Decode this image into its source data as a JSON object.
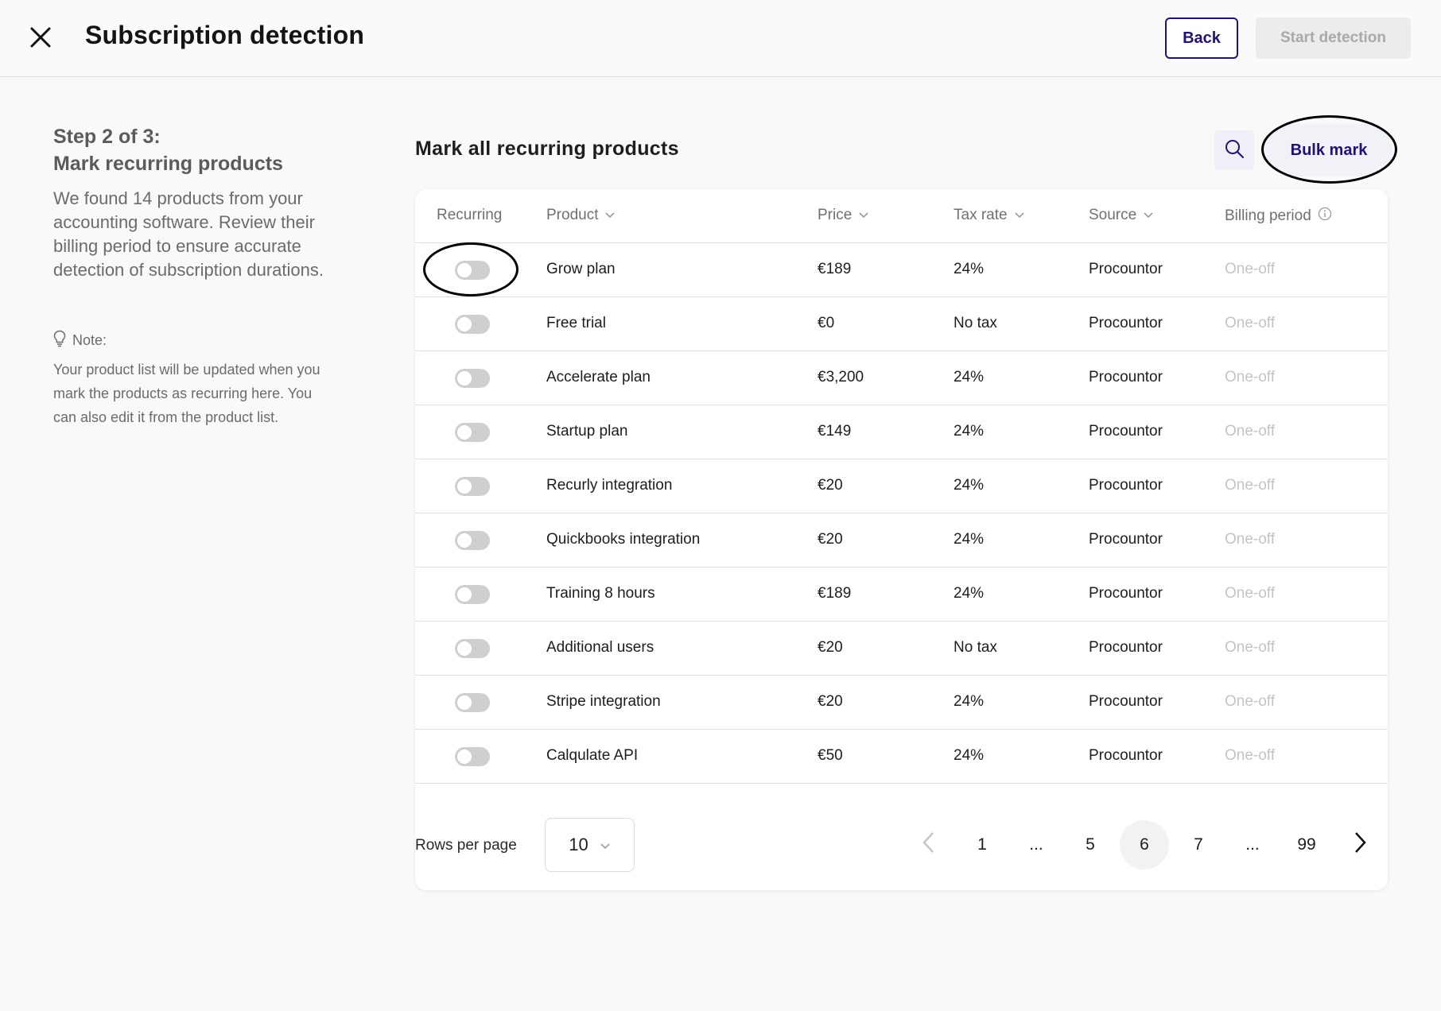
{
  "header": {
    "title": "Subscription detection",
    "back_label": "Back",
    "start_label": "Start detection"
  },
  "left": {
    "step_line1": "Step 2 of 3:",
    "step_line2": "Mark recurring products",
    "description": "We found 14 products from your accounting software. Review their billing period to ensure accurate detection of subscription durations.",
    "note_label": "Note:",
    "note_text": "Your product list will be updated when you mark the products as recurring here. You can also edit it from the product list."
  },
  "main": {
    "heading": "Mark all recurring products",
    "bulk_label": "Bulk mark"
  },
  "table": {
    "columns": {
      "recurring": "Recurring",
      "product": "Product",
      "price": "Price",
      "tax": "Tax rate",
      "source": "Source",
      "billing": "Billing period"
    },
    "rows": [
      {
        "product": "Grow plan",
        "price": "€189",
        "tax": "24%",
        "source": "Procountor",
        "billing": "One-off",
        "recurring": false
      },
      {
        "product": "Free trial",
        "price": "€0",
        "tax": "No tax",
        "source": "Procountor",
        "billing": "One-off",
        "recurring": false
      },
      {
        "product": "Accelerate plan",
        "price": "€3,200",
        "tax": "24%",
        "source": "Procountor",
        "billing": "One-off",
        "recurring": false
      },
      {
        "product": "Startup plan",
        "price": "€149",
        "tax": "24%",
        "source": "Procountor",
        "billing": "One-off",
        "recurring": false
      },
      {
        "product": "Recurly integration",
        "price": "€20",
        "tax": "24%",
        "source": "Procountor",
        "billing": "One-off",
        "recurring": false
      },
      {
        "product": "Quickbooks integration",
        "price": "€20",
        "tax": "24%",
        "source": "Procountor",
        "billing": "One-off",
        "recurring": false
      },
      {
        "product": "Training 8 hours",
        "price": "€189",
        "tax": "24%",
        "source": "Procountor",
        "billing": "One-off",
        "recurring": false
      },
      {
        "product": "Additional users",
        "price": "€20",
        "tax": "No tax",
        "source": "Procountor",
        "billing": "One-off",
        "recurring": false
      },
      {
        "product": "Stripe integration",
        "price": "€20",
        "tax": "24%",
        "source": "Procountor",
        "billing": "One-off",
        "recurring": false
      },
      {
        "product": "Calqulate API",
        "price": "€50",
        "tax": "24%",
        "source": "Procountor",
        "billing": "One-off",
        "recurring": false
      }
    ]
  },
  "pagination": {
    "rows_label": "Rows per page",
    "rows_value": "10",
    "pages": [
      "1",
      "...",
      "5",
      "6",
      "7",
      "...",
      "99"
    ],
    "current": "6"
  },
  "colors": {
    "accent": "#23107a",
    "toggle_off": "#cfcfcf",
    "muted_text": "#c4c4c4"
  }
}
